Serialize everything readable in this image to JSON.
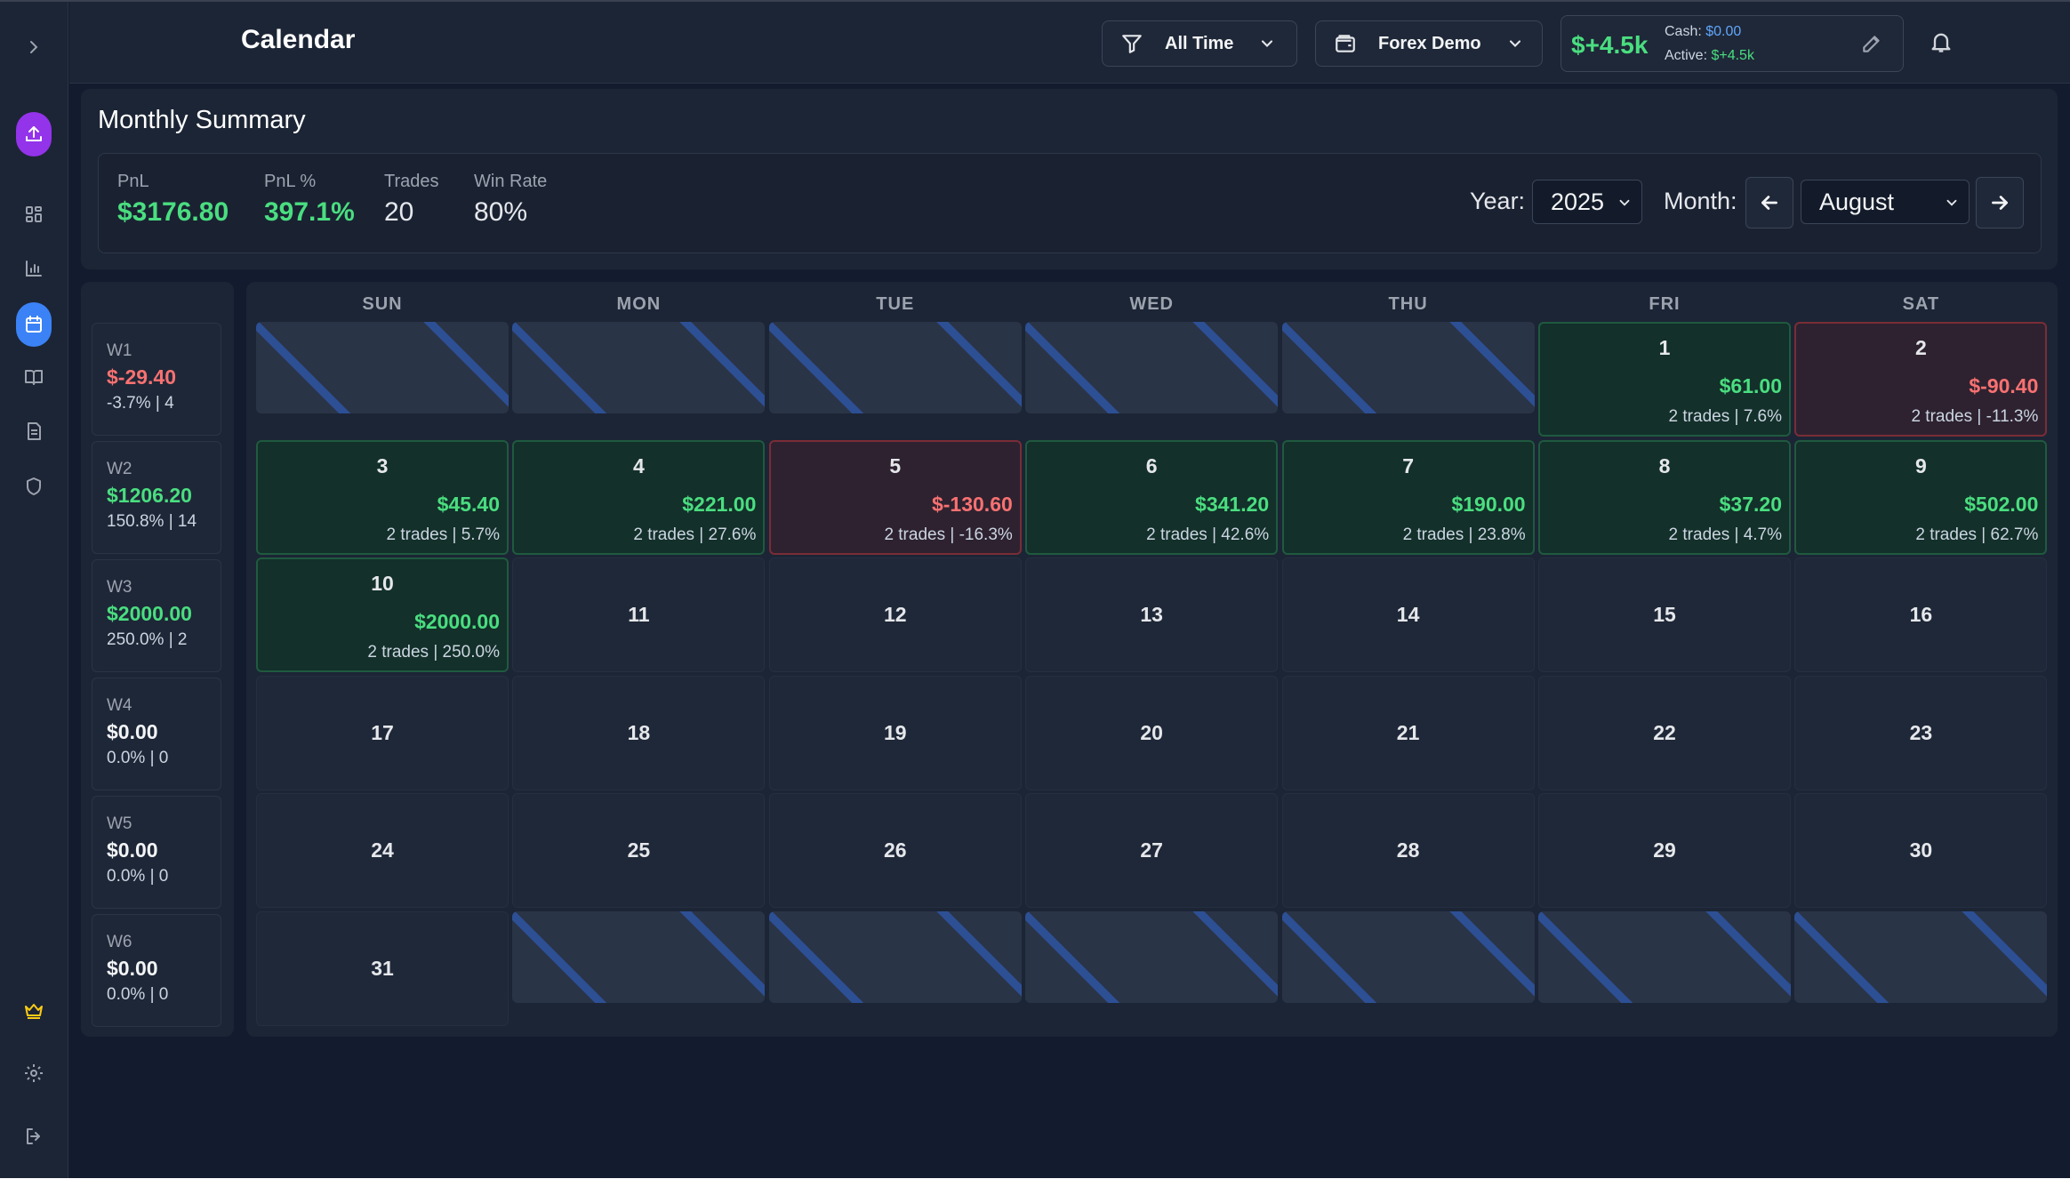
{
  "header": {
    "title": "Calendar",
    "filter_label": "All Time",
    "account_label": "Forex Demo",
    "balance_main": "$+4.5k",
    "cash_label": "Cash:",
    "cash_value": "$0.00",
    "active_label": "Active:",
    "active_value": "$+4.5k"
  },
  "sidebar": {
    "icons": [
      "chevron-right-icon",
      "upload-icon",
      "dashboard-icon",
      "bar-chart-icon",
      "calendar-icon",
      "book-icon",
      "document-icon",
      "shield-icon",
      "crown-icon",
      "gear-icon",
      "logout-icon"
    ],
    "active": "calendar-icon"
  },
  "summary": {
    "title": "Monthly Summary",
    "pnl_label": "PnL",
    "pnl_value": "$3176.80",
    "pnl_pct_label": "PnL %",
    "pnl_pct_value": "397.1%",
    "trades_label": "Trades",
    "trades_value": "20",
    "winrate_label": "Win Rate",
    "winrate_value": "80%",
    "year_label": "Year:",
    "year_value": "2025",
    "month_label": "Month:",
    "month_value": "August"
  },
  "weekdays": [
    "SUN",
    "MON",
    "TUE",
    "WED",
    "THU",
    "FRI",
    "SAT"
  ],
  "weeks": [
    {
      "label": "W1",
      "pnl": "$-29.40",
      "sub": "-3.7% | 4",
      "status": "loss"
    },
    {
      "label": "W2",
      "pnl": "$1206.20",
      "sub": "150.8% | 14",
      "status": "win"
    },
    {
      "label": "W3",
      "pnl": "$2000.00",
      "sub": "250.0% | 2",
      "status": "win"
    },
    {
      "label": "W4",
      "pnl": "$0.00",
      "sub": "0.0% | 0",
      "status": "neutral"
    },
    {
      "label": "W5",
      "pnl": "$0.00",
      "sub": "0.0% | 0",
      "status": "neutral"
    },
    {
      "label": "W6",
      "pnl": "$0.00",
      "sub": "0.0% | 0",
      "status": "neutral"
    }
  ],
  "days": [
    {
      "day": "1",
      "pnl": "$61.00",
      "sub": "2 trades | 7.6%",
      "status": "win"
    },
    {
      "day": "2",
      "pnl": "$-90.40",
      "sub": "2 trades | -11.3%",
      "status": "loss"
    },
    {
      "day": "3",
      "pnl": "$45.40",
      "sub": "2 trades | 5.7%",
      "status": "win"
    },
    {
      "day": "4",
      "pnl": "$221.00",
      "sub": "2 trades | 27.6%",
      "status": "win"
    },
    {
      "day": "5",
      "pnl": "$-130.60",
      "sub": "2 trades | -16.3%",
      "status": "loss"
    },
    {
      "day": "6",
      "pnl": "$341.20",
      "sub": "2 trades | 42.6%",
      "status": "win"
    },
    {
      "day": "7",
      "pnl": "$190.00",
      "sub": "2 trades | 23.8%",
      "status": "win"
    },
    {
      "day": "8",
      "pnl": "$37.20",
      "sub": "2 trades | 4.7%",
      "status": "win"
    },
    {
      "day": "9",
      "pnl": "$502.00",
      "sub": "2 trades | 62.7%",
      "status": "win"
    },
    {
      "day": "10",
      "pnl": "$2000.00",
      "sub": "2 trades | 250.0%",
      "status": "win"
    },
    {
      "day": "11"
    },
    {
      "day": "12"
    },
    {
      "day": "13"
    },
    {
      "day": "14"
    },
    {
      "day": "15"
    },
    {
      "day": "16"
    },
    {
      "day": "17"
    },
    {
      "day": "18"
    },
    {
      "day": "19"
    },
    {
      "day": "20"
    },
    {
      "day": "21"
    },
    {
      "day": "22"
    },
    {
      "day": "23"
    },
    {
      "day": "24"
    },
    {
      "day": "25"
    },
    {
      "day": "26"
    },
    {
      "day": "27"
    },
    {
      "day": "28"
    },
    {
      "day": "29"
    },
    {
      "day": "30"
    },
    {
      "day": "31"
    }
  ],
  "colors": {
    "win": "#4ade80",
    "loss": "#f87171",
    "accent": "#3b82f6",
    "upload": "#9333ea",
    "crown": "#facc15"
  }
}
